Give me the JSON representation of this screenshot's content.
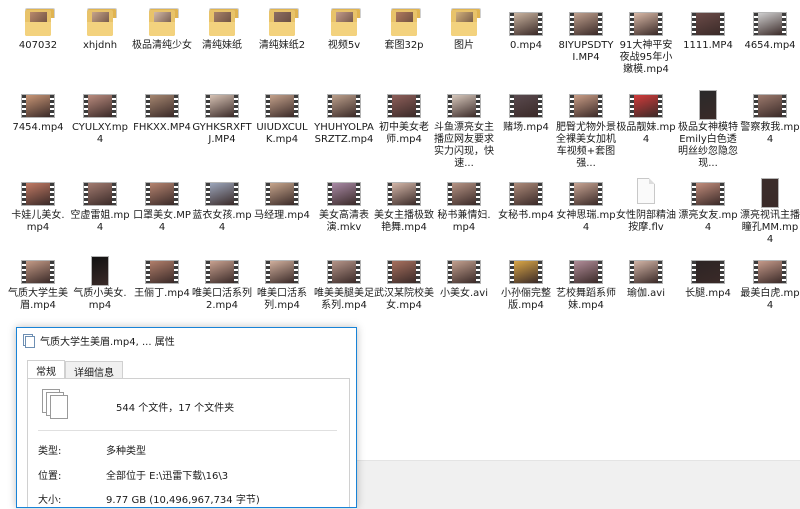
{
  "explorer": {
    "items": [
      {
        "label": "407032",
        "type": "folder",
        "pic": "#b98a6c"
      },
      {
        "label": "xhjdnh",
        "type": "folder",
        "pic": "#c7a48a"
      },
      {
        "label": "极品清纯少女",
        "type": "folder",
        "pic": "#d3b9a8"
      },
      {
        "label": "清纯妹纸",
        "type": "folder",
        "pic": "#a8826a"
      },
      {
        "label": "清纯妹纸2",
        "type": "folder",
        "pic": "#8d6e63"
      },
      {
        "label": "视频5v",
        "type": "folder",
        "pic": "#c29b8a"
      },
      {
        "label": "套图32p",
        "type": "folder",
        "pic": "#b07a5e"
      },
      {
        "label": "图片",
        "type": "folder",
        "pic": "#d1b07b"
      },
      {
        "label": "0.mp4",
        "type": "video",
        "pic": "#c9b39f"
      },
      {
        "label": "8IYUPSDTYI.MP4",
        "type": "video",
        "pic": "#bfa08e"
      },
      {
        "label": "91大神平安夜战95年小嫩模.mp4",
        "type": "video",
        "pic": "#d8b8a6"
      },
      {
        "label": "1111.MP4",
        "type": "video",
        "pic": "#6b4b48"
      },
      {
        "label": "4654.mp4",
        "type": "video",
        "pic": "#cfcfcf"
      },
      {
        "label": "7454.mp4",
        "type": "video",
        "pic": "#c89676"
      },
      {
        "label": "CYULXY.mp4",
        "type": "video",
        "pic": "#b98b7e"
      },
      {
        "label": "FHKXX.MP4",
        "type": "video",
        "pic": "#a58670"
      },
      {
        "label": "GYHKSRXFTJ.MP4",
        "type": "video",
        "pic": "#d6c2b4"
      },
      {
        "label": "UIUDXCULK.mp4",
        "type": "video",
        "pic": "#c3a18b"
      },
      {
        "label": "YHUHYOLPASRZTZ.mp4",
        "type": "video",
        "pic": "#bca08c"
      },
      {
        "label": "初中美女老师.mp4",
        "type": "video",
        "pic": "#8e5f5a"
      },
      {
        "label": "斗鱼漂亮女主播应网友要求实力闪现，快速...",
        "type": "video",
        "pic": "#d7c8bc"
      },
      {
        "label": "赌场.mp4",
        "type": "video",
        "pic": "#5a4a4f"
      },
      {
        "label": "肥臀尤物外景全裸美女加机车视频+套图 强...",
        "type": "video",
        "pic": "#c99d86"
      },
      {
        "label": "极品靓妹.mp4",
        "type": "video",
        "pic": "#d23b3b"
      },
      {
        "label": "极品女神模特Emily白色透明丝纱忽隐忽现...",
        "type": "video",
        "pic": "#2a2a2a",
        "portrait": true
      },
      {
        "label": "警察救我.mp4",
        "type": "video",
        "pic": "#9c7a6d"
      },
      {
        "label": "卡娃儿美女.mp4",
        "type": "video",
        "pic": "#c17a64"
      },
      {
        "label": "空虚雷姐.mp4",
        "type": "video",
        "pic": "#a27b70"
      },
      {
        "label": "口罩美女.MP4",
        "type": "video",
        "pic": "#b58470"
      },
      {
        "label": "蓝衣女孩.mp4",
        "type": "video",
        "pic": "#9ca6bb"
      },
      {
        "label": "马经理.mp4",
        "type": "video",
        "pic": "#c6a58c"
      },
      {
        "label": "美女高清表演.mkv",
        "type": "video",
        "pic": "#a98aa6"
      },
      {
        "label": "美女主播极致艳舞.mp4",
        "type": "video",
        "pic": "#d3b6a8"
      },
      {
        "label": "秘书兼情妇.mp4",
        "type": "video",
        "pic": "#b69485"
      },
      {
        "label": "女秘书.mp4",
        "type": "video",
        "pic": "#ad8b7a"
      },
      {
        "label": "女神思瑞.mp4",
        "type": "video",
        "pic": "#c7a493"
      },
      {
        "label": "女性阴部精油按摩.flv",
        "type": "file"
      },
      {
        "label": "漂亮女友.mp4",
        "type": "video",
        "pic": "#c18d7c"
      },
      {
        "label": "漂亮视讯主播瞳孔MM.mp4",
        "type": "video",
        "pic": "#3b2d2b",
        "portrait": true
      },
      {
        "label": "气质大学生美眉.mp4",
        "type": "video",
        "pic": "#c39a86"
      },
      {
        "label": "气质小美女.mp4",
        "type": "video",
        "pic": "#111111",
        "portrait": true
      },
      {
        "label": "王俪丁.mp4",
        "type": "video",
        "pic": "#b07e6a"
      },
      {
        "label": "唯美口活系列 2.mp4",
        "type": "video",
        "pic": "#c7a08f"
      },
      {
        "label": "唯美口活系列.mp4",
        "type": "video",
        "pic": "#cfae9c"
      },
      {
        "label": "唯美美腿美足系列.mp4",
        "type": "video",
        "pic": "#b59589"
      },
      {
        "label": "武汉某院校美女.mp4",
        "type": "video",
        "pic": "#a7705e"
      },
      {
        "label": "小美女.avi",
        "type": "video",
        "pic": "#c2a08f"
      },
      {
        "label": "小孙俪完整版.mp4",
        "type": "video",
        "pic": "#d9a646"
      },
      {
        "label": "艺校舞蹈系师妹.mp4",
        "type": "video",
        "pic": "#b18d99"
      },
      {
        "label": "瑜伽.avi",
        "type": "video",
        "pic": "#d2b4a6"
      },
      {
        "label": "长腿.mp4",
        "type": "video",
        "pic": "#2c2424"
      },
      {
        "label": "最美白虎.mp4",
        "type": "video",
        "pic": "#c59a8a"
      }
    ]
  },
  "dialog": {
    "title": "气质大学生美眉.mp4, ... 属性",
    "tabs": [
      "常规",
      "详细信息"
    ],
    "summary": "544 个文件，17 个文件夹",
    "rows": [
      {
        "key": "类型:",
        "value": "多种类型"
      },
      {
        "key": "位置:",
        "value": "全部位于 E:\\迅雷下载\\16\\3"
      },
      {
        "key": "大小:",
        "value": "9.77 GB (10,496,967,734 字节)"
      }
    ]
  }
}
